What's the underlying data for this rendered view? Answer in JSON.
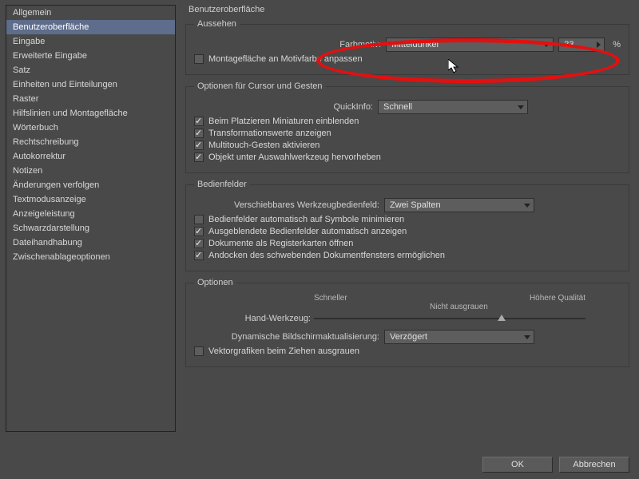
{
  "sidebar": {
    "items": [
      "Allgemein",
      "Benutzeroberfläche",
      "Eingabe",
      "Erweiterte Eingabe",
      "Satz",
      "Einheiten und Einteilungen",
      "Raster",
      "Hilfslinien und Montagefläche",
      "Wörterbuch",
      "Rechtschreibung",
      "Autokorrektur",
      "Notizen",
      "Änderungen verfolgen",
      "Textmodusanzeige",
      "Anzeigeleistung",
      "Schwarzdarstellung",
      "Dateihandhabung",
      "Zwischenablageoptionen"
    ],
    "selectedIndex": 1
  },
  "page_title": "Benutzeroberfläche",
  "appearance": {
    "legend": "Aussehen",
    "color_theme_label": "Farbmotiv:",
    "color_theme_value": "Mitteldunkel",
    "brightness_value": "33",
    "percent": "%",
    "match_pasteboard_label": "Montagefläche an Motivfarbe anpassen",
    "match_pasteboard_checked": false
  },
  "cursor_gestures": {
    "legend": "Optionen für Cursor und Gesten",
    "tooltip_label": "QuickInfo:",
    "tooltip_value": "Schnell",
    "checks": [
      {
        "label": "Beim Platzieren Miniaturen einblenden",
        "on": true
      },
      {
        "label": "Transformationswerte anzeigen",
        "on": true
      },
      {
        "label": "Multitouch-Gesten aktivieren",
        "on": true
      },
      {
        "label": "Objekt unter Auswahlwerkzeug hervorheben",
        "on": true
      }
    ]
  },
  "panels": {
    "legend": "Bedienfelder",
    "floating_label": "Verschiebbares Werkzeugbedienfeld:",
    "floating_value": "Zwei Spalten",
    "checks": [
      {
        "label": "Bedienfelder automatisch auf Symbole minimieren",
        "on": false
      },
      {
        "label": "Ausgeblendete Bedienfelder automatisch anzeigen",
        "on": true
      },
      {
        "label": "Dokumente als Registerkarten öffnen",
        "on": true
      },
      {
        "label": "Andocken des schwebenden Dokumentfensters ermöglichen",
        "on": true
      }
    ]
  },
  "options": {
    "legend": "Optionen",
    "hand_tool_label": "Hand-Werkzeug:",
    "faster_label": "Schneller",
    "quality_label": "Höhere Qualität",
    "no_greek_label": "Nicht ausgrauen",
    "dyn_update_label": "Dynamische Bildschirmaktualisierung:",
    "dyn_update_value": "Verzögert",
    "greek_vector_label": "Vektorgrafiken beim Ziehen ausgrauen",
    "greek_vector_checked": false
  },
  "buttons": {
    "ok": "OK",
    "cancel": "Abbrechen"
  },
  "annotation": {
    "kind": "ellipse-highlight",
    "color": "#e21010"
  }
}
